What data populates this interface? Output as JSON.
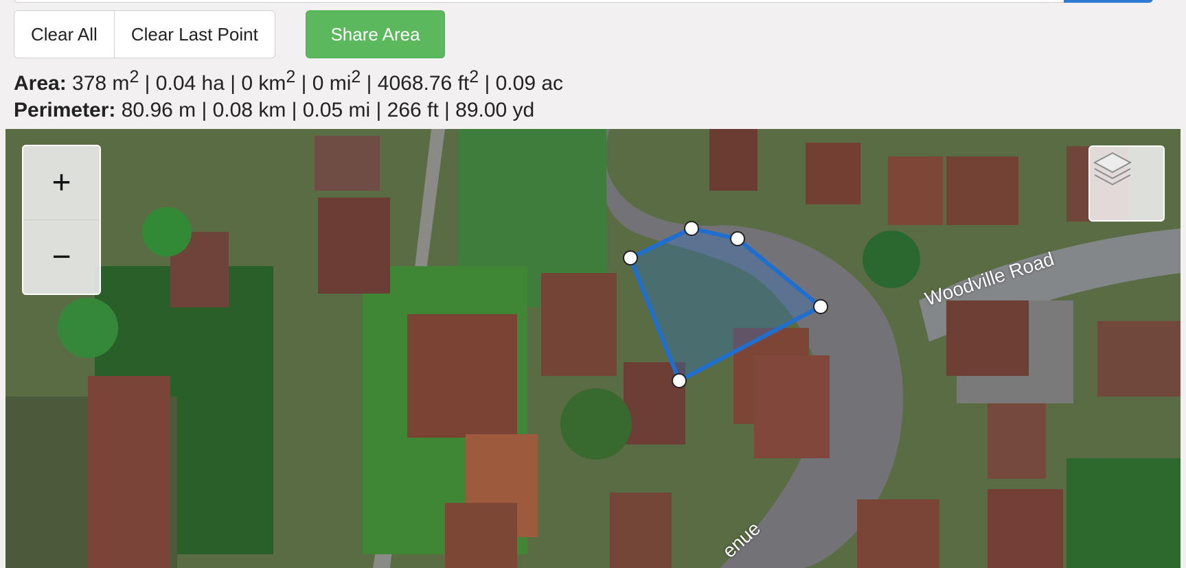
{
  "toolbar": {
    "clear_all_label": "Clear All",
    "clear_last_point_label": "Clear Last Point",
    "share_area_label": "Share Area"
  },
  "stats": {
    "area_label": "Area:",
    "area_m2": "378 m",
    "area_ha": " | 0.04 ha | 0 km",
    "area_mi": " | 0 mi",
    "area_ft": " | 4068.76 ft",
    "area_ac": " | 0.09 ac",
    "superscript": "2",
    "perimeter_label": "Perimeter:",
    "perimeter_value": "80.96 m | 0.08 km | 0.05 mi | 266 ft | 89.00 yd"
  },
  "map": {
    "zoom_in_label": "+",
    "zoom_out_label": "−",
    "layers_icon": "layers-icon",
    "street_labels": [
      "Woodville Road",
      "enue"
    ]
  },
  "colors": {
    "share_button": "#5cb85c",
    "polygon_stroke": "#1f6fd1",
    "accent_button": "#2b7bd6"
  }
}
